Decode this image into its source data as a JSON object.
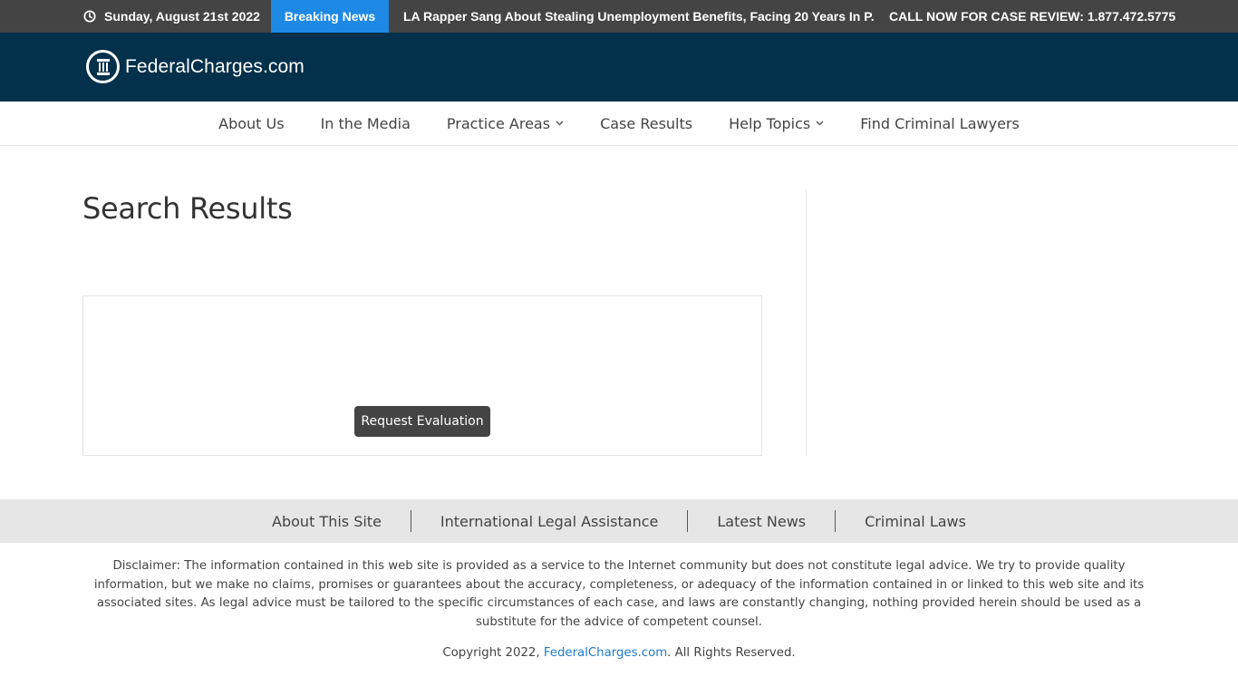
{
  "topbar": {
    "date_icon": "clock-icon",
    "date": "Sunday, August 21st 2022",
    "breaking_label": "Breaking News",
    "headline": "LA Rapper Sang About Stealing Unemployment Benefits, Facing 20 Years In P...",
    "phone_cta": "CALL NOW FOR CASE REVIEW: 1.877.472.5775"
  },
  "header": {
    "logo_icon": "pillar-icon",
    "logo_text": "FederalCharges.com"
  },
  "nav": {
    "items": [
      {
        "label": "About Us",
        "has_dropdown": false
      },
      {
        "label": "In the Media",
        "has_dropdown": false
      },
      {
        "label": "Practice Areas",
        "has_dropdown": true
      },
      {
        "label": "Case Results",
        "has_dropdown": false
      },
      {
        "label": "Help Topics",
        "has_dropdown": true
      },
      {
        "label": "Find Criminal Lawyers",
        "has_dropdown": false
      }
    ]
  },
  "main": {
    "title": "Search Results",
    "request_button": "Request Evaluation"
  },
  "footer": {
    "links": [
      "About This Site",
      "International Legal Assistance",
      "Latest News",
      "Criminal Laws"
    ],
    "disclaimer": "Disclaimer: The information contained in this web site is provided as a service to the Internet community but does not constitute legal advice. We try to provide quality information, but we make no claims, promises or guarantees about the accuracy, completeness, or adequacy of the information contained in or linked to this web site and its associated sites. As legal advice must be tailored to the specific circumstances of each case, and laws are constantly changing, nothing provided herein should be used as a substitute for the advice of competent counsel.",
    "copyright_prefix": "Copyright 2022, ",
    "copyright_link": "FederalCharges.com",
    "copyright_suffix": ". All Rights Reserved."
  },
  "colors": {
    "topbar_bg": "#444444",
    "breaking_bg": "#1e88e5",
    "header_bg": "#03304b",
    "footer_nav_bg": "#e6e6e6",
    "link": "#1e7bc8"
  }
}
